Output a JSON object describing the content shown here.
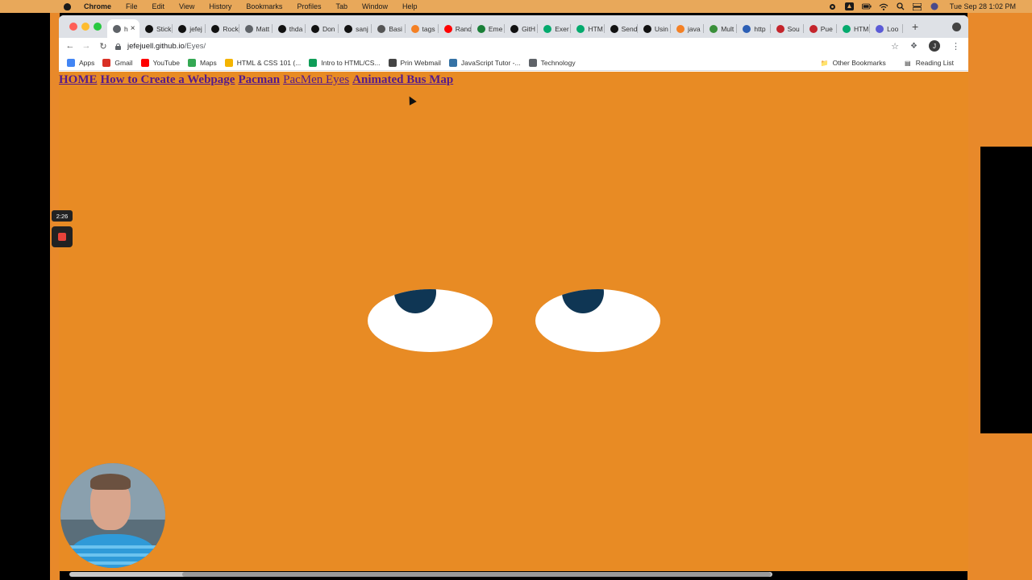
{
  "menubar": {
    "app": "Chrome",
    "items": [
      "File",
      "Edit",
      "View",
      "History",
      "Bookmarks",
      "Profiles",
      "Tab",
      "Window",
      "Help"
    ],
    "clock": "Tue Sep 28  1:02 PM"
  },
  "tabs": [
    {
      "label": "h",
      "icon": "compass-icon",
      "color": "#5f6368",
      "active": true
    },
    {
      "label": "Stick",
      "icon": "github-icon",
      "color": "#111111"
    },
    {
      "label": "jefej",
      "icon": "github-icon",
      "color": "#111111"
    },
    {
      "label": "Rock",
      "icon": "github-icon",
      "color": "#111111"
    },
    {
      "label": "Matt",
      "icon": "compass-icon",
      "color": "#5f6368"
    },
    {
      "label": "thda",
      "icon": "github-icon",
      "color": "#111111"
    },
    {
      "label": "Don",
      "icon": "github-icon",
      "color": "#111111"
    },
    {
      "label": "sanj",
      "icon": "github-icon",
      "color": "#111111"
    },
    {
      "label": "Basi",
      "icon": "grid-icon",
      "color": "#555555"
    },
    {
      "label": "tags",
      "icon": "stack-icon",
      "color": "#f48024"
    },
    {
      "label": "Rand",
      "icon": "youtube-icon",
      "color": "#ff0000"
    },
    {
      "label": "Eme",
      "icon": "e-icon",
      "color": "#1a7f37"
    },
    {
      "label": "GitH",
      "icon": "github-icon",
      "color": "#111111"
    },
    {
      "label": "Exer",
      "icon": "w3-icon",
      "color": "#04aa6d"
    },
    {
      "label": "HTM",
      "icon": "w3-icon",
      "color": "#04aa6d"
    },
    {
      "label": "Send",
      "icon": "box-icon",
      "color": "#111111"
    },
    {
      "label": "Usin",
      "icon": "box-icon",
      "color": "#111111"
    },
    {
      "label": "java",
      "icon": "stack-icon",
      "color": "#f48024"
    },
    {
      "label": "Mult",
      "icon": "link-icon",
      "color": "#3a8f3a"
    },
    {
      "label": "http",
      "icon": "p-icon",
      "color": "#2c5fb5"
    },
    {
      "label": "Sou",
      "icon": "shield-icon",
      "color": "#c4242b"
    },
    {
      "label": "Pue",
      "icon": "shield-icon",
      "color": "#c4242b"
    },
    {
      "label": "HTM",
      "icon": "w3-icon",
      "color": "#04aa6d"
    },
    {
      "label": "Loo",
      "icon": "gear-icon",
      "color": "#5b5bd6"
    }
  ],
  "address": {
    "host": "jefejuell.github.io",
    "path": "/Eyes/"
  },
  "bookmarks": [
    {
      "label": "Apps",
      "icon": "apps-grid-icon",
      "color": "#4285f4"
    },
    {
      "label": "Gmail",
      "icon": "gmail-icon",
      "color": "#d93025"
    },
    {
      "label": "YouTube",
      "icon": "youtube-icon",
      "color": "#ff0000"
    },
    {
      "label": "Maps",
      "icon": "maps-pin-icon",
      "color": "#34a853"
    },
    {
      "label": "HTML & CSS 101 (...",
      "icon": "slides-icon",
      "color": "#f4b400"
    },
    {
      "label": "Intro to HTML/CS...",
      "icon": "shield-check-icon",
      "color": "#0f9d58"
    },
    {
      "label": "Prin Webmail",
      "icon": "globe-icon",
      "color": "#444444"
    },
    {
      "label": "JavaScript Tutor -...",
      "icon": "python-icon",
      "color": "#3572a5"
    },
    {
      "label": "Technology",
      "icon": "folder-icon",
      "color": "#5f6368"
    }
  ],
  "bookmarks_right": [
    "Other Bookmarks",
    "Reading List"
  ],
  "profile_initial": "J",
  "page": {
    "background": "#e88b24",
    "links": [
      {
        "label": "HOME",
        "bold": true
      },
      {
        "label": "How to Create a Webpage",
        "bold": true
      },
      {
        "label": "Pacman",
        "bold": true
      },
      {
        "label": "PacMen Eyes",
        "bold": false
      },
      {
        "label": "Animated Bus Map",
        "bold": true
      }
    ]
  },
  "recorder": {
    "timer": "2:26"
  }
}
